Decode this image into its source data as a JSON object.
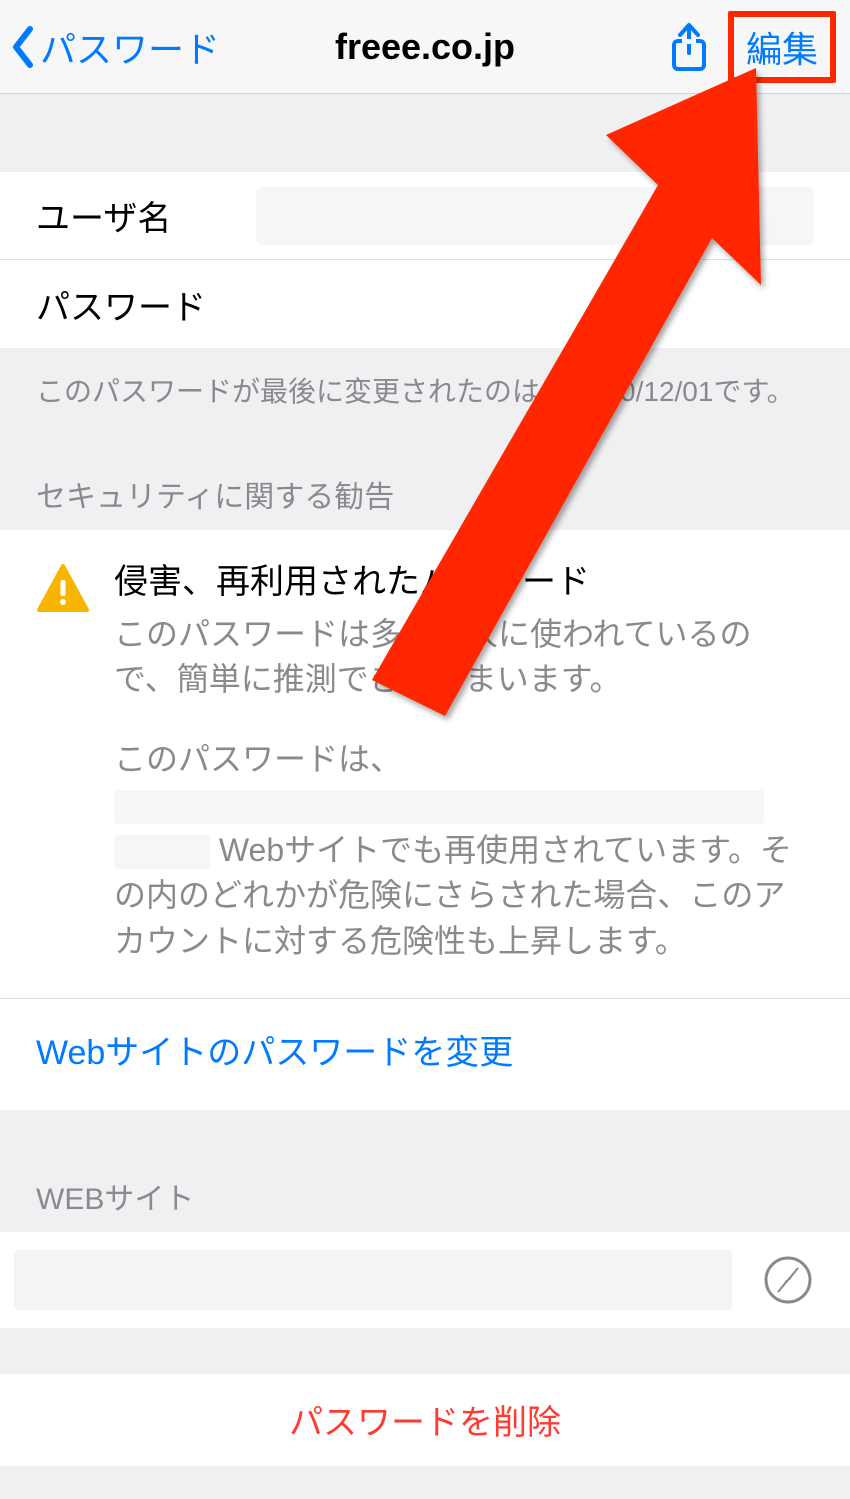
{
  "navbar": {
    "back_label": "パスワード",
    "title": "freee.co.jp",
    "edit_label": "編集"
  },
  "credentials": {
    "username_label": "ユーザ名",
    "password_label": "パスワード",
    "last_changed_prefix": "このパスワードが最後に変更されたのは",
    "last_changed_date": "0/12/01",
    "last_changed_suffix": "です。"
  },
  "security": {
    "header": "セキュリティに関する勧告",
    "title": "侵害、再利用されたパスワード",
    "description": "このパスワードは多くの人に使われているので、簡単に推測できてしまいます。",
    "reuse_prefix": "このパスワードは、",
    "reuse_mid": "Webサイトでも再使用されています。その内のどれかが危険にさらされた場合、このアカウントに対する危険性も上昇します。",
    "change_link": "Webサイトのパスワードを変更"
  },
  "website": {
    "header": "WEBサイト"
  },
  "actions": {
    "delete_label": "パスワードを削除"
  },
  "colors": {
    "link": "#007aff",
    "destructive": "#ff3b30",
    "annotation": "#ff2600"
  }
}
